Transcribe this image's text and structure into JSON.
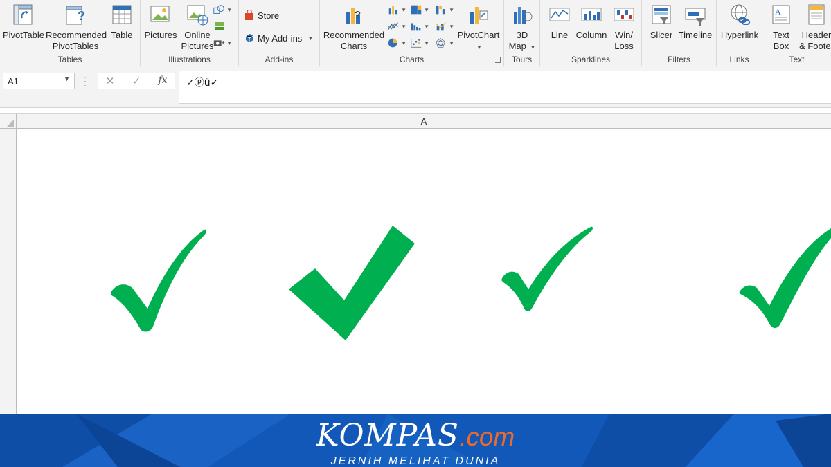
{
  "ribbon": {
    "groups": {
      "tables": "Tables",
      "illustrations": "Illustrations",
      "addins": "Add-ins",
      "charts": "Charts",
      "tours": "Tours",
      "sparklines": "Sparklines",
      "filters": "Filters",
      "links": "Links",
      "text": "Text"
    },
    "buttons": {
      "pivottable": "PivotTable",
      "recommended_pivottables_1": "Recommended",
      "recommended_pivottables_2": "PivotTables",
      "table": "Table",
      "pictures": "Pictures",
      "online_pictures_1": "Online",
      "online_pictures_2": "Pictures",
      "store": "Store",
      "my_addins": "My Add-ins",
      "recommended_charts_1": "Recommended",
      "recommended_charts_2": "Charts",
      "pivotchart": "PivotChart",
      "map3d_1": "3D",
      "map3d_2": "Map",
      "line": "Line",
      "column": "Column",
      "winloss_1": "Win/",
      "winloss_2": "Loss",
      "slicer": "Slicer",
      "timeline": "Timeline",
      "hyperlink": "Hyperlink",
      "textbox_1": "Text",
      "textbox_2": "Box",
      "header_footer_1": "Header",
      "header_footer_2": "& Footer"
    }
  },
  "formula_bar": {
    "name_box": "A1",
    "cancel_glyph": "✕",
    "enter_glyph": "✓",
    "fx_label": "fx",
    "formula": "✓ⓟü✓"
  },
  "sheet": {
    "column_header": "A",
    "checkmarks": [
      "check-style-1",
      "check-style-2",
      "check-style-3",
      "check-style-4"
    ],
    "check_color": "#00b050"
  },
  "banner": {
    "brand_name": "KOMPAS",
    "brand_suffix": ".com",
    "tagline": "JERNIH MELIHAT DUNIA",
    "bg_color": "#1158b8",
    "accent": "#ee6a2a"
  }
}
